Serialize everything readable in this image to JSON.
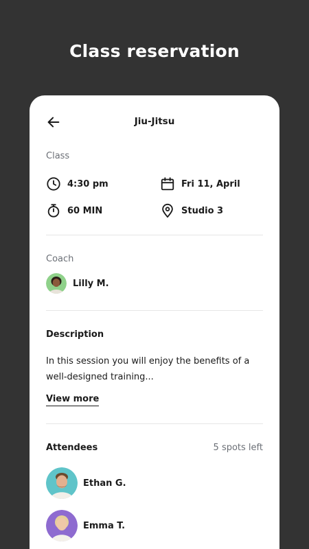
{
  "page": {
    "headline": "Class reservation"
  },
  "header": {
    "title": "Jiu-Jitsu"
  },
  "class_section": {
    "label": "Class",
    "time": "4:30 pm",
    "date": "Fri 11, April",
    "duration": "60 MIN",
    "location": "Studio 3"
  },
  "coach_section": {
    "label": "Coach",
    "name": "Lilly M."
  },
  "description_section": {
    "heading": "Description",
    "text": "In this session you will enjoy the benefits of a well-designed training...",
    "view_more": "View more"
  },
  "attendees_section": {
    "heading": "Attendees",
    "spots_left": "5 spots left",
    "attendees": [
      {
        "name": "Ethan G.",
        "avatar_bg": "#5fc4c9"
      },
      {
        "name": "Emma T.",
        "avatar_bg": "#8e6bd0"
      }
    ]
  },
  "colors": {
    "background": "#333333",
    "card": "#ffffff",
    "text_primary": "#1a1a1a",
    "text_secondary": "#6b6f76",
    "coach_avatar_bg": "#8fd18a"
  },
  "icons": [
    "back-arrow-icon",
    "clock-icon",
    "calendar-icon",
    "stopwatch-icon",
    "location-pin-icon"
  ]
}
